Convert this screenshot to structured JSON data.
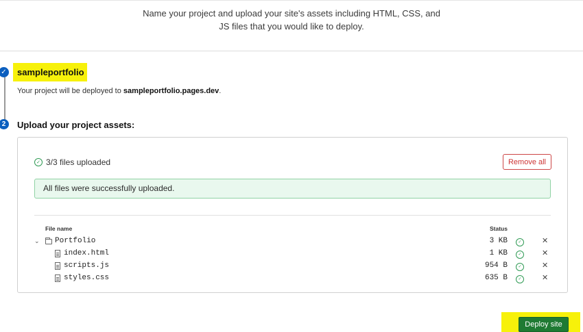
{
  "intro": {
    "line1": "Name your project and upload your site's assets including HTML, CSS, and",
    "line2": "JS files that you would like to deploy."
  },
  "step1": {
    "number": "✓",
    "project_name": "sampleportfolio",
    "deploy_prefix": "Your project will be deployed to ",
    "deploy_domain": "sampleportfolio.pages.dev",
    "deploy_suffix": "."
  },
  "step2": {
    "number": "2",
    "title": "Upload your project assets:"
  },
  "panel": {
    "uploaded_text": "3/3 files uploaded",
    "remove_all_label": "Remove all",
    "success_message": "All files were successfully uploaded.",
    "columns": {
      "file_name": "File name",
      "status": "Status"
    },
    "rows": [
      {
        "name": "Portfolio",
        "size": "3 KB",
        "type": "folder"
      },
      {
        "name": "index.html",
        "size": "1 KB",
        "type": "file"
      },
      {
        "name": "scripts.js",
        "size": "954 B",
        "type": "file"
      },
      {
        "name": "styles.css",
        "size": "635 B",
        "type": "file"
      }
    ]
  },
  "deploy_label": "Deploy site",
  "colors": {
    "accent_blue": "#0b5fbf",
    "success_green": "#2f9a54",
    "deploy_green": "#1f7a33",
    "highlight_yellow": "#f7f10a",
    "danger_red": "#cc3333"
  },
  "icons": [
    "check-circle-icon",
    "chevron-down-icon",
    "folder-icon",
    "file-icon",
    "close-icon"
  ]
}
